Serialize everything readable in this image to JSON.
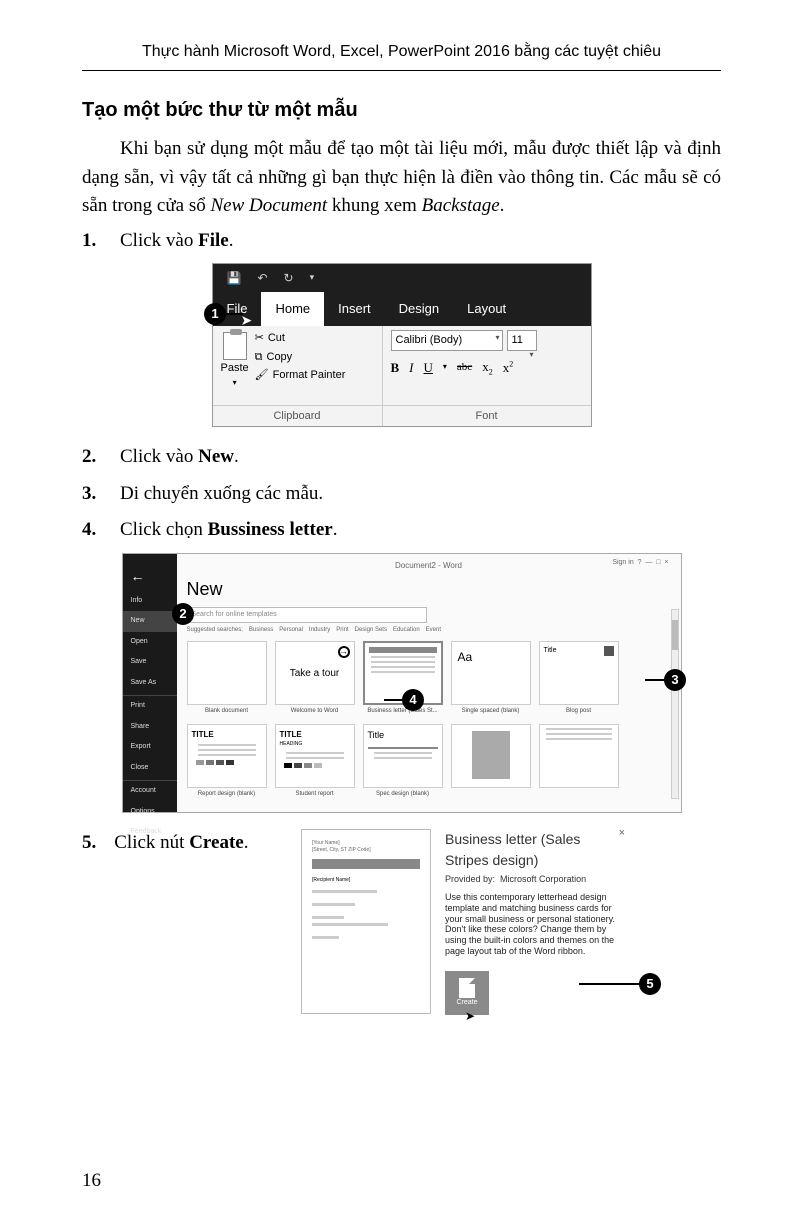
{
  "header": "Thực hành Microsoft Word, Excel, PowerPoint 2016 bằng các tuyệt chiêu",
  "section_title": "Tạo một bức thư từ một mẫu",
  "paragraph_parts": {
    "p1a": "Khi bạn sử dụng một mẫu để tạo một tài liệu mới, mẫu được thiết lập và định dạng sẵn, vì vậy tất cả những gì bạn thực hiện là điền vào thông tin. Các mẫu sẽ có sẵn trong cửa sổ ",
    "p1b": "New Document",
    "p1c": " khung xem ",
    "p1d": "Backstage",
    "p1e": "."
  },
  "steps": {
    "s1": {
      "n": "1.",
      "a": "Click vào ",
      "b": "File",
      "c": "."
    },
    "s2": {
      "n": "2.",
      "a": "Click vào ",
      "b": "New",
      "c": "."
    },
    "s3": {
      "n": "3.",
      "a": "Di chuyển xuống các mẫu."
    },
    "s4": {
      "n": "4.",
      "a": "Click chọn ",
      "b": "Bussiness letter",
      "c": "."
    },
    "s5": {
      "n": "5.",
      "a": "Click nút ",
      "b": "Create",
      "c": "."
    }
  },
  "fig1": {
    "tabs": {
      "file": "File",
      "home": "Home",
      "insert": "Insert",
      "design": "Design",
      "layout": "Layout"
    },
    "paste": "Paste",
    "cut": "Cut",
    "copy": "Copy",
    "format_painter": "Format Painter",
    "clipboard": "Clipboard",
    "font_name": "Calibri (Body)",
    "font_size": "11",
    "font_group": "Font"
  },
  "fig2": {
    "doc_title": "Document2 - Word",
    "signin": "Sign in",
    "new": "New",
    "search_ph": "Search for online templates",
    "suggest_label": "Suggested searches:",
    "suggest": [
      "Business",
      "Personal",
      "Industry",
      "Print",
      "Design Sets",
      "Education",
      "Event"
    ],
    "side": [
      "Info",
      "New",
      "Open",
      "Save",
      "Save As",
      "Print",
      "Share",
      "Export",
      "Close",
      "Account",
      "Options",
      "Feedback"
    ],
    "tpl_row1": [
      "Blank document",
      "Welcome to Word",
      "Business letter (Sales St...",
      "Single spaced (blank)",
      "Blog post"
    ],
    "tpl_row2": [
      "Report design (blank)",
      "Student report",
      "Spec design (blank)",
      "",
      ""
    ],
    "take_tour": "Take a tour",
    "aa": "Aa",
    "title": "Title",
    "title2": "TITLE",
    "heading": "HEADING"
  },
  "fig3": {
    "title": "Business letter (Sales Stripes design)",
    "provider_label": "Provided by:",
    "provider": "Microsoft Corporation",
    "desc": "Use this contemporary letterhead design template and matching business cards for your small business or personal stationery. Don't like these colors? Change them by using the built-in colors and themes on the page layout tab of the Word ribbon.",
    "create": "Create"
  },
  "callouts": {
    "c1": "1",
    "c2": "2",
    "c3": "3",
    "c4": "4",
    "c5": "5"
  },
  "page_num": "16"
}
